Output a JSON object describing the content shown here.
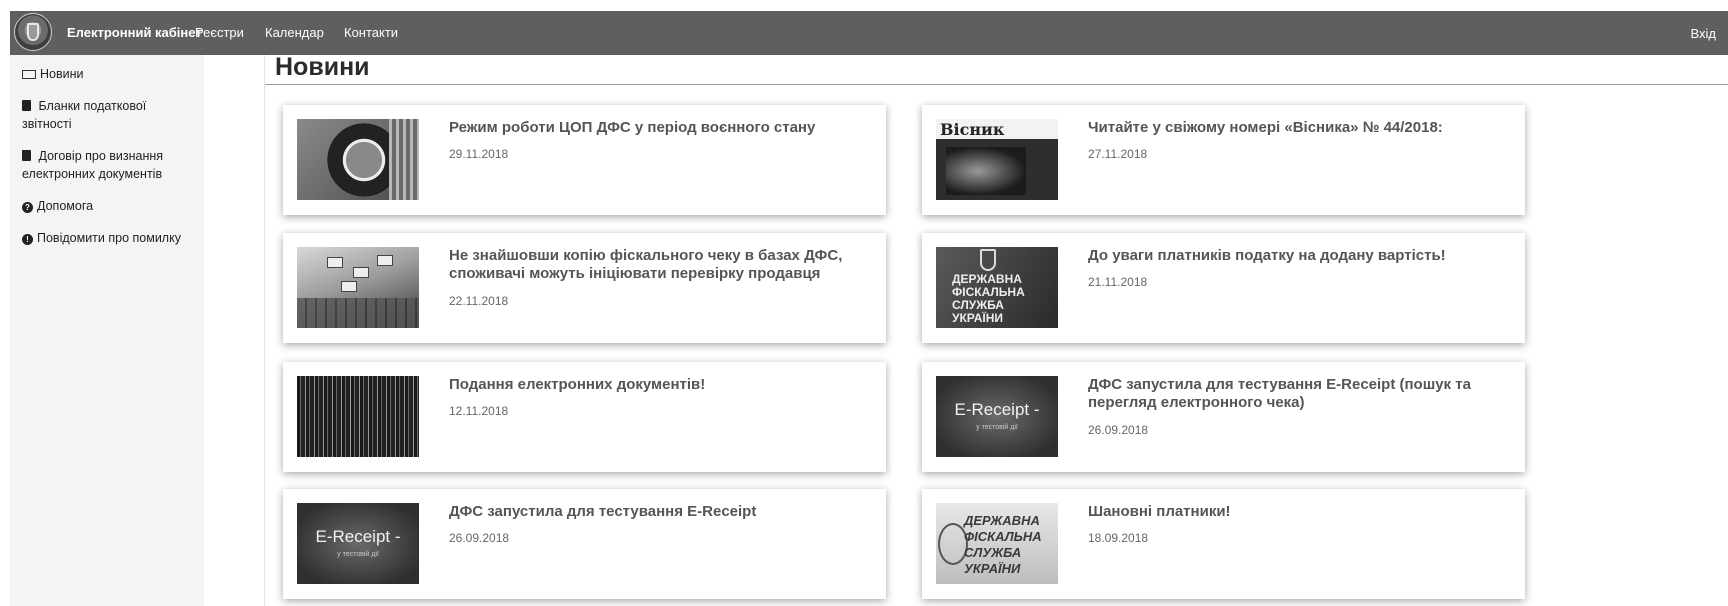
{
  "header": {
    "brand": "Електронний кабінет",
    "nav": [
      "Реєстри",
      "Календар",
      "Контакти"
    ],
    "login": "Вхід"
  },
  "sidebar": {
    "items": [
      {
        "label": "Новини",
        "icon": "newspaper-icon"
      },
      {
        "label": "Бланки податкової звітності",
        "icon": "book-icon"
      },
      {
        "label": "Договір про визнання електронних документів",
        "icon": "book-icon"
      },
      {
        "label": "Допомога",
        "icon": "question-circle-icon"
      },
      {
        "label": "Повідомити про помилку",
        "icon": "exclamation-circle-icon"
      }
    ]
  },
  "main": {
    "title": "Новини",
    "news": [
      {
        "title": "Режим роботи ЦОП ДФС у період воєнного стану",
        "date": "29.11.2018"
      },
      {
        "title": "Читайте у свіжому номері «Вісника» № 44/2018:",
        "date": "27.11.2018",
        "thumb_text": "Вісник"
      },
      {
        "title": "Не знайшовши копію фіскального чеку в базах ДФС, споживачі можуть ініціювати перевірку продавця",
        "date": "22.11.2018"
      },
      {
        "title": "До уваги платників податку на додану вартість!",
        "date": "21.11.2018",
        "thumb_text": "ДЕРЖАВНА ФІСКАЛЬНА СЛУЖБА УКРАЇНИ"
      },
      {
        "title": "Подання електронних документів!",
        "date": "12.11.2018"
      },
      {
        "title": "ДФС запустила для тестування E-Receipt (пошук та перегляд електронного чека)",
        "date": "26.09.2018",
        "thumb_text": "E-Receipt -",
        "thumb_sub": "у тестовій дії"
      },
      {
        "title": "ДФС запустила для тестування E-Receipt",
        "date": "26.09.2018",
        "thumb_text": "E-Receipt -",
        "thumb_sub": "у тестовій дії"
      },
      {
        "title": "Шановні платники!",
        "date": "18.09.2018",
        "thumb_text": "ДЕРЖАВНА ФІСКАЛЬНА СЛУЖБА УКРАЇНИ"
      }
    ]
  }
}
